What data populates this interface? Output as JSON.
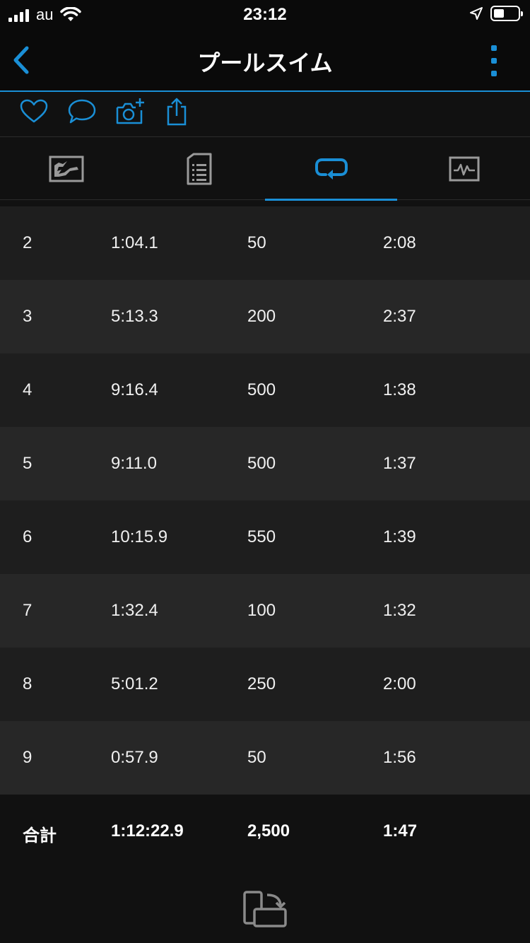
{
  "status_bar": {
    "carrier": "au",
    "time": "23:12"
  },
  "header": {
    "title": "プールスイム"
  },
  "action_icons": [
    "heart-icon",
    "comment-icon",
    "add-photo-icon",
    "share-icon"
  ],
  "tabs": [
    {
      "icon": "chart-overview-icon",
      "active": false
    },
    {
      "icon": "details-list-icon",
      "active": false
    },
    {
      "icon": "laps-icon",
      "active": true
    },
    {
      "icon": "graph-icon",
      "active": false
    }
  ],
  "laps": [
    [
      "2",
      "1:04.1",
      "50",
      "2:08"
    ],
    [
      "3",
      "5:13.3",
      "200",
      "2:37"
    ],
    [
      "4",
      "9:16.4",
      "500",
      "1:38"
    ],
    [
      "5",
      "9:11.0",
      "500",
      "1:37"
    ],
    [
      "6",
      "10:15.9",
      "550",
      "1:39"
    ],
    [
      "7",
      "1:32.4",
      "100",
      "1:32"
    ],
    [
      "8",
      "5:01.2",
      "250",
      "2:00"
    ],
    [
      "9",
      "0:57.9",
      "50",
      "1:56"
    ]
  ],
  "total": {
    "label": "合計",
    "time": "1:12:22.9",
    "distance": "2,500",
    "pace": "1:47"
  },
  "colors": {
    "accent": "#1a8fd6",
    "background": "#111111",
    "row_a": "#1e1e1e",
    "row_b": "#272727",
    "icon_gray": "#9a9a9a"
  }
}
